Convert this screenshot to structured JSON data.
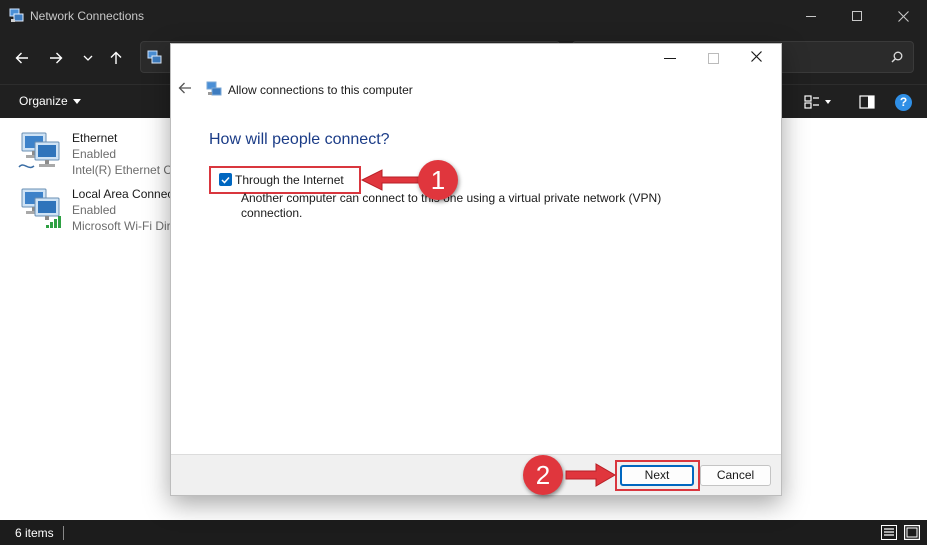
{
  "window": {
    "title": "Network Connections",
    "controls": [
      "minimize",
      "maximize",
      "close"
    ]
  },
  "toolbar": {
    "organize_label": "Organize"
  },
  "connections": [
    {
      "name": "Ethernet",
      "status": "Enabled",
      "device": "Intel(R) Ethernet Co",
      "icon": "ethernet-adapter-icon"
    },
    {
      "name": "Local Area Connec",
      "status": "Enabled",
      "device": "Microsoft Wi-Fi Dir",
      "icon": "wifi-adapter-icon"
    }
  ],
  "statusbar": {
    "item_count": "6 items"
  },
  "dialog": {
    "title": "Allow connections to this computer",
    "heading": "How will people connect?",
    "option": {
      "label": "Through the Internet",
      "checked": true,
      "description": "Another computer can connect to this one using a virtual private network (VPN) connection."
    },
    "next_label": "Next",
    "cancel_label": "Cancel"
  },
  "annotations": [
    {
      "number": "1",
      "target": "through-the-internet-checkbox"
    },
    {
      "number": "2",
      "target": "next-button"
    }
  ],
  "colors": {
    "accent": "#0067c0",
    "highlight": "#d9363e",
    "badge": "#e0363d",
    "heading": "#1b3c87",
    "help": "#2f8fe6"
  }
}
